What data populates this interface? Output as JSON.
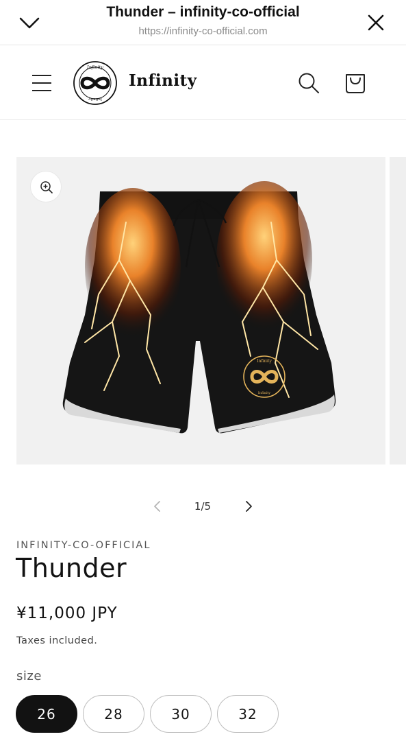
{
  "browser": {
    "title": "Thunder – infinity-co-official",
    "url": "https://infinity-co-official.com",
    "icons": {
      "collapse": "chevron-down-icon",
      "close": "close-icon"
    }
  },
  "header": {
    "brand": "Infinity",
    "logo_ring_text_top": "Infinity",
    "logo_ring_text_bottom": "Infinity",
    "icons": {
      "menu": "hamburger-icon",
      "search": "search-icon",
      "cart": "cart-icon"
    }
  },
  "product": {
    "image_alt": "Thunder board shorts",
    "emblem_top": "Infinity",
    "emblem_bottom": "Infinity",
    "slider": {
      "counter": "1/5"
    },
    "vendor": "INFINITY-CO-OFFICIAL",
    "title": "Thunder",
    "price": "¥11,000 JPY",
    "tax_note": "Taxes included.",
    "option_label": "size",
    "sizes": [
      "26",
      "28",
      "30",
      "32"
    ],
    "selected_size": "26"
  },
  "colors": {
    "text": "#121212",
    "selected_pill": "#121212",
    "image_bg": "#f1f1f1",
    "lightning": "#f3a43a",
    "emblem_gold": "#e3b35a"
  }
}
